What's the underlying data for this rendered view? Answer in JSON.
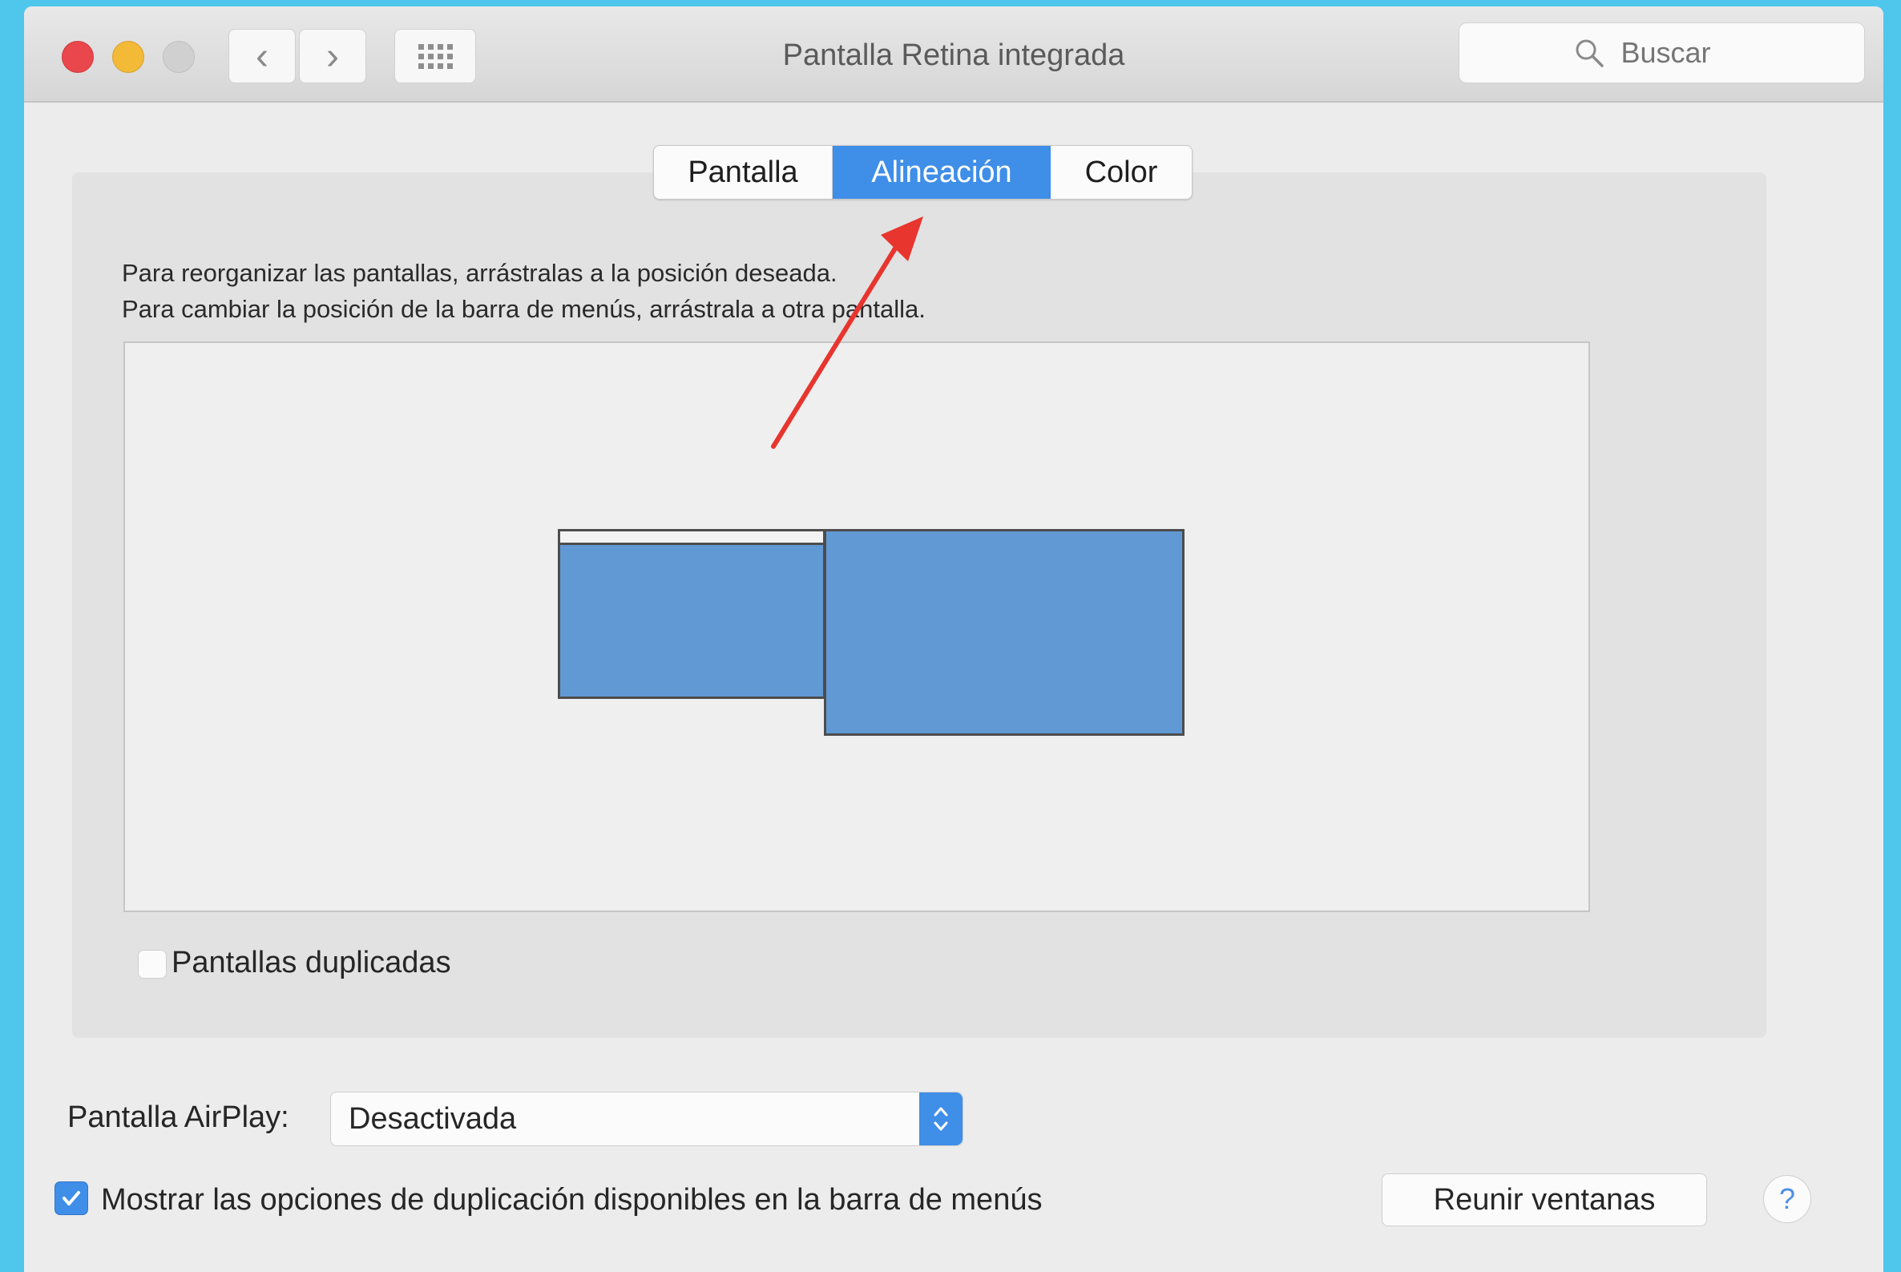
{
  "window": {
    "title": "Pantalla Retina integrada"
  },
  "toolbar": {
    "back_glyph": "‹",
    "forward_glyph": "›",
    "search_placeholder": "Buscar"
  },
  "tabs": [
    {
      "label": "Pantalla",
      "selected": false
    },
    {
      "label": "Alineación",
      "selected": true
    },
    {
      "label": "Color",
      "selected": false
    }
  ],
  "arrangement": {
    "instruction_line1": "Para reorganizar las pantallas, arrástralas a la posición deseada.",
    "instruction_line2": "Para cambiar la posición de la barra de menús, arrástrala a otra pantalla."
  },
  "mirror_displays": {
    "label": "Pantallas duplicadas",
    "checked": false
  },
  "airplay": {
    "label": "Pantalla AirPlay:",
    "value": "Desactivada"
  },
  "show_mirroring_options": {
    "label": "Mostrar las opciones de duplicación disponibles en la barra de menús",
    "checked": true
  },
  "buttons": {
    "gather_windows": "Reunir ventanas",
    "help": "?"
  },
  "colors": {
    "accent": "#3f8ee8",
    "display": "#6199d5",
    "annotation_arrow": "#e8352e"
  },
  "icons": {
    "close": "close-icon",
    "minimize": "minimize-icon",
    "zoom": "zoom-icon",
    "show_all": "grid-icon",
    "search": "search-icon",
    "popup_stepper": "chevron-updown-icon",
    "checkmark": "checkmark-icon",
    "annotation": "red-arrow-icon"
  }
}
